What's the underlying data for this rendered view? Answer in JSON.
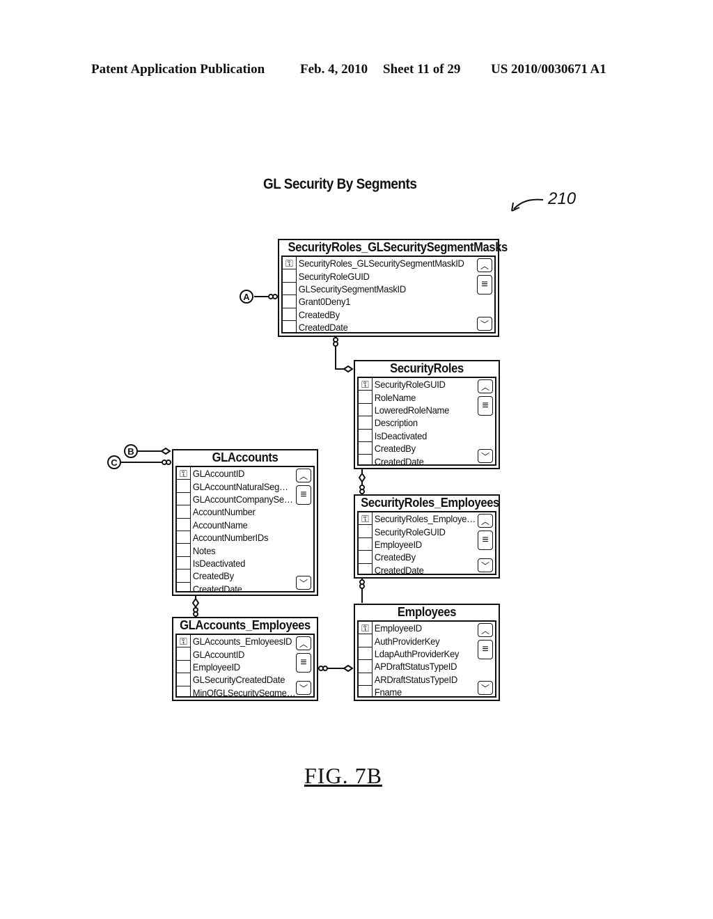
{
  "header": {
    "publication": "Patent Application Publication",
    "date": "Feb. 4, 2010",
    "sheet": "Sheet 11 of 29",
    "patent_number": "US 2010/0030671 A1"
  },
  "diagram": {
    "title": "GL Security By Segments",
    "reference_number": "210",
    "figure_label": "FIG.  7B",
    "off_page_connectors": [
      "A",
      "B",
      "C"
    ]
  },
  "tables": {
    "srsm": {
      "name": "SecurityRoles_GLSecuritySegmentMasks",
      "fields": [
        "SecurityRoles_GLSecuritySegmentMaskID",
        "SecurityRoleGUID",
        "GLSecuritySegmentMaskID",
        "Grant0Deny1",
        "CreatedBy",
        "CreatedDate"
      ]
    },
    "sr": {
      "name": "SecurityRoles",
      "fields": [
        "SecurityRoleGUID",
        "RoleName",
        "LoweredRoleName",
        "Description",
        "IsDeactivated",
        "CreatedBy",
        "CreatedDate"
      ]
    },
    "gla": {
      "name": "GLAccounts",
      "fields": [
        "GLAccountID",
        "GLAccountNaturalSeg…",
        "GLAccountCompanySe…",
        "AccountNumber",
        "AccountName",
        "AccountNumberIDs",
        "Notes",
        "IsDeactivated",
        "CreatedBy",
        "CreatedDate"
      ]
    },
    "sre": {
      "name": "SecurityRoles_Employees",
      "fields": [
        "SecurityRoles_Employe…",
        "SecurityRoleGUID",
        "EmployeeID",
        "CreatedBy",
        "CreatedDate"
      ]
    },
    "glae": {
      "name": "GLAccounts_Employees",
      "fields": [
        "GLAccounts_EmloyeesID",
        "GLAccountID",
        "EmployeeID",
        "GLSecurityCreatedDate",
        "MinOfGLSecuritySegme…"
      ]
    },
    "emp": {
      "name": "Employees",
      "fields": [
        "EmployeeID",
        "AuthProviderKey",
        "LdapAuthProviderKey",
        "APDraftStatusTypeID",
        "ARDraftStatusTypeID",
        "Fname"
      ]
    }
  },
  "icons": {
    "key": "⚿",
    "scroll_up": "︿",
    "scroll_thumb": "≡",
    "scroll_down": "﹀"
  }
}
